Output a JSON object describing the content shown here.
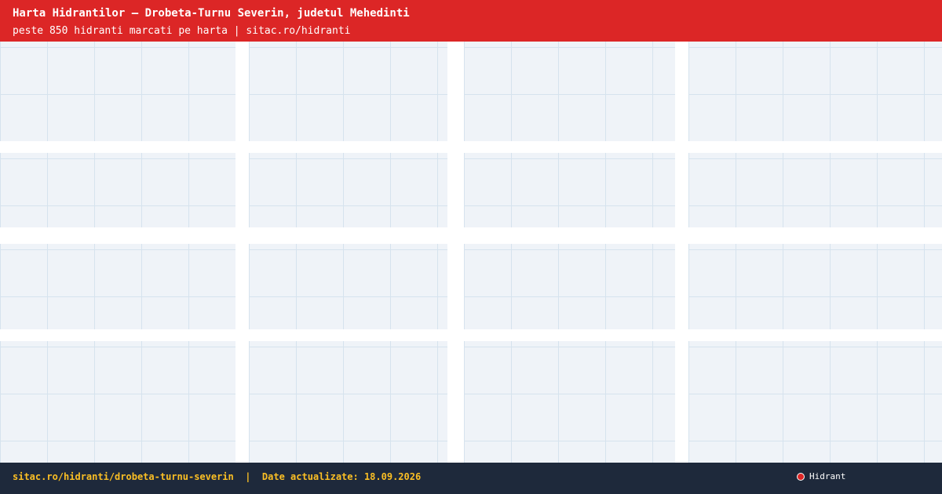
{
  "header": {
    "title": "Harta Hidrantilor – Drobeta-Turnu Severin, judetul Mehedinti",
    "subtitle": "peste 850 hidranti marcati pe harta | sitac.ro/hidranti"
  },
  "footer": {
    "url": "sitac.ro/hidranti/drobeta-turnu-severin",
    "separator": "|",
    "date_text": "Date actualizate: 18.09.2026"
  },
  "legend": {
    "label": "Hidrant",
    "icon": "hydrant-marker-icon",
    "color": "#dc2626"
  },
  "colors": {
    "header_bg": "#dc2626",
    "footer_bg": "#1e293b",
    "footer_text": "#fbbf24",
    "block_fill": "#eff3f8",
    "grid_line": "#d6e3ee"
  }
}
